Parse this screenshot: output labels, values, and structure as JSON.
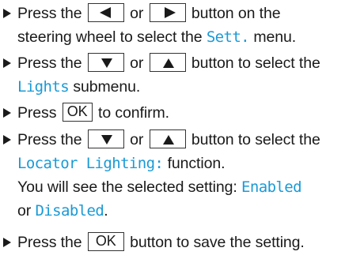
{
  "steps": [
    {
      "lines": [
        {
          "t1": "Press the ",
          "t2": " or ",
          "t3": " button on the"
        },
        {
          "t1": "steering wheel to select the ",
          "hl": "Sett.",
          "t2": " menu."
        }
      ],
      "keys": [
        "left-arrow",
        "right-arrow"
      ]
    },
    {
      "lines": [
        {
          "t1": "Press the ",
          "t2": " or ",
          "t3": " button to select the"
        },
        {
          "hl": "Lights",
          "t2": " submenu."
        }
      ],
      "keys": [
        "down-arrow",
        "up-arrow"
      ]
    },
    {
      "lines": [
        {
          "t1": "Press ",
          "key": "OK",
          "t2": " to confirm."
        }
      ]
    },
    {
      "lines": [
        {
          "t1": "Press the ",
          "t2": " or ",
          "t3": " button to select the"
        },
        {
          "hl": "Locator Lighting:",
          "t2": " function."
        },
        {
          "t1": "You will see the selected setting: ",
          "hl": "Enabled"
        },
        {
          "t1": "or ",
          "hl": "Disabled",
          "t2": "."
        }
      ],
      "keys": [
        "down-arrow",
        "up-arrow"
      ]
    },
    {
      "lines": [
        {
          "t1": "Press the ",
          "key": "OK",
          "t2": " button to save the setting."
        }
      ]
    }
  ],
  "icons": {
    "bullet": "right-pointing-triangle",
    "left": "left-arrow-icon",
    "right": "right-arrow-icon",
    "down": "down-arrow-icon",
    "up": "up-arrow-icon"
  },
  "colors": {
    "text": "#1a1a1a",
    "highlight": "#1a9ad6"
  }
}
